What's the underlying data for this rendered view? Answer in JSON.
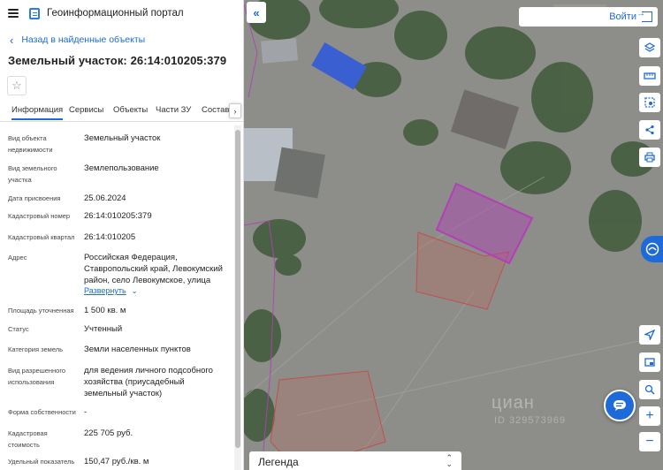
{
  "header": {
    "title": "Геоинформационный портал"
  },
  "nav": {
    "back_label": "Назад в найденные объекты"
  },
  "object": {
    "title": "Земельный участок: 26:14:010205:379"
  },
  "tabs": [
    {
      "label": "Информация",
      "active": true
    },
    {
      "label": "Сервисы",
      "active": false
    },
    {
      "label": "Объекты",
      "active": false
    },
    {
      "label": "Части ЗУ",
      "active": false
    },
    {
      "label": "Состав",
      "active": false
    }
  ],
  "properties": [
    {
      "label": "Вид объекта недвижимости",
      "value": "Земельный участок"
    },
    {
      "label": "Вид земельного участка",
      "value": "Землепользование"
    },
    {
      "label": "Дата присвоения",
      "value": "25.06.2024"
    },
    {
      "label": "Кадастровый номер",
      "value": "26:14:010205:379"
    },
    {
      "label": "Кадастровый квартал",
      "value": "26:14:010205"
    },
    {
      "label": "Адрес",
      "value": "Российская Федерация, Ставропольский край, Левокумский район, село Левокумское, улица",
      "expand": "Развернуть"
    },
    {
      "label": "Площадь уточненная",
      "value": "1 500 кв. м"
    },
    {
      "label": "Статус",
      "value": "Учтенный"
    },
    {
      "label": "Категория земель",
      "value": "Земли населенных пунктов"
    },
    {
      "label": "Вид разрешенного использования",
      "value": "для ведения личного подсобного хозяйства (приусадебный земельный участок)"
    },
    {
      "label": "Форма собственности",
      "value": "-"
    },
    {
      "label": "Кадастровая стоимость",
      "value": "225 705 руб."
    },
    {
      "label": "Удельный показатель",
      "value": "150,47 руб./кв. м"
    }
  ],
  "map": {
    "login_label": "Войти",
    "legend_label": "Легенда",
    "watermark": "циан",
    "watermark_id": "ID 329573969"
  },
  "icons": {
    "menu": "hamburger-icon",
    "logo": "portal-logo-icon",
    "back": "chevron-left-icon",
    "favorite": "star-icon",
    "collapse": "double-chevron-left-icon",
    "login": "login-icon",
    "layers": "layers-icon",
    "ruler": "ruler-icon",
    "select": "area-select-icon",
    "share": "share-icon",
    "print": "print-icon",
    "locate": "location-arrow-icon",
    "minimap": "minimap-icon",
    "geo": "geo-search-icon",
    "zoom_in": "plus-icon",
    "zoom_out": "minus-icon",
    "chat": "chat-icon"
  },
  "colors": {
    "accent": "#1e6ad8",
    "parcel": "#b23fb8",
    "neighbor": "#c0504d"
  }
}
